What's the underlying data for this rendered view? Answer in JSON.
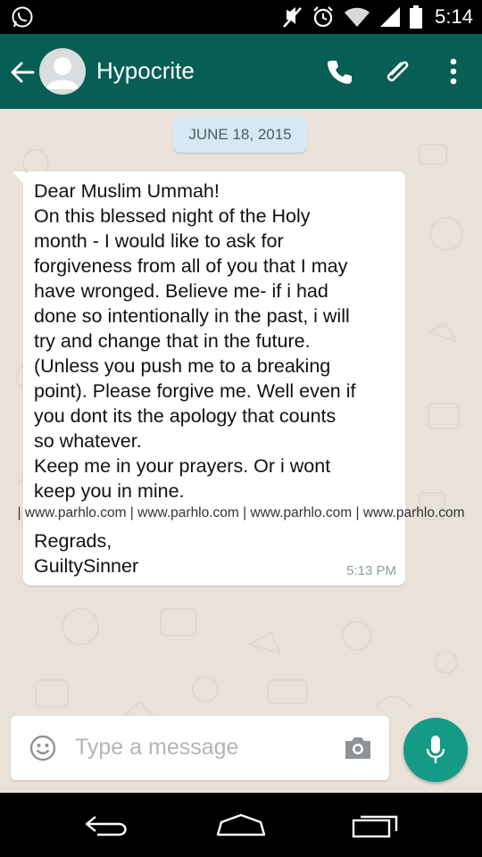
{
  "status_bar": {
    "time": "5:14"
  },
  "header": {
    "contact_name": "Hypocrite"
  },
  "chat": {
    "date_label": "JUNE 18, 2015",
    "message": {
      "lines": [
        "Dear Muslim Ummah!",
        "On this blessed night of the Holy",
        "month - I would like to ask for",
        "forgiveness from all of you that I may",
        "have wronged. Believe me- if i had",
        "done so intentionally in the past, i will",
        "try and change that in the future.",
        "(Unless you push me to a breaking",
        "point). Please forgive me. Well even if",
        "you dont its the apology that counts",
        "so whatever.",
        "Keep me in your prayers. Or i wont",
        "keep you in mine."
      ],
      "signoff_lines": [
        "Regrads,",
        "GuiltySinner"
      ],
      "time": "5:13 PM"
    },
    "watermark": "| www.parhlo.com | www.parhlo.com | www.parhlo.com | www.parhlo.com"
  },
  "composer": {
    "placeholder": "Type a message"
  },
  "icons": {
    "status": [
      "whatsapp-icon",
      "mute-icon",
      "alarm-icon",
      "wifi-icon",
      "signal-icon",
      "battery-icon"
    ],
    "header": [
      "back-arrow-icon",
      "avatar-icon",
      "call-icon",
      "attach-icon",
      "more-icon"
    ],
    "composer": [
      "emoji-icon",
      "camera-icon",
      "mic-icon"
    ],
    "nav": [
      "nav-back-icon",
      "nav-home-icon",
      "nav-recents-icon"
    ]
  },
  "colors": {
    "app_bar": "#075e54",
    "mic_button": "#159a85",
    "date_chip": "#d5e9f4",
    "chat_background": "#e9e2d9"
  }
}
